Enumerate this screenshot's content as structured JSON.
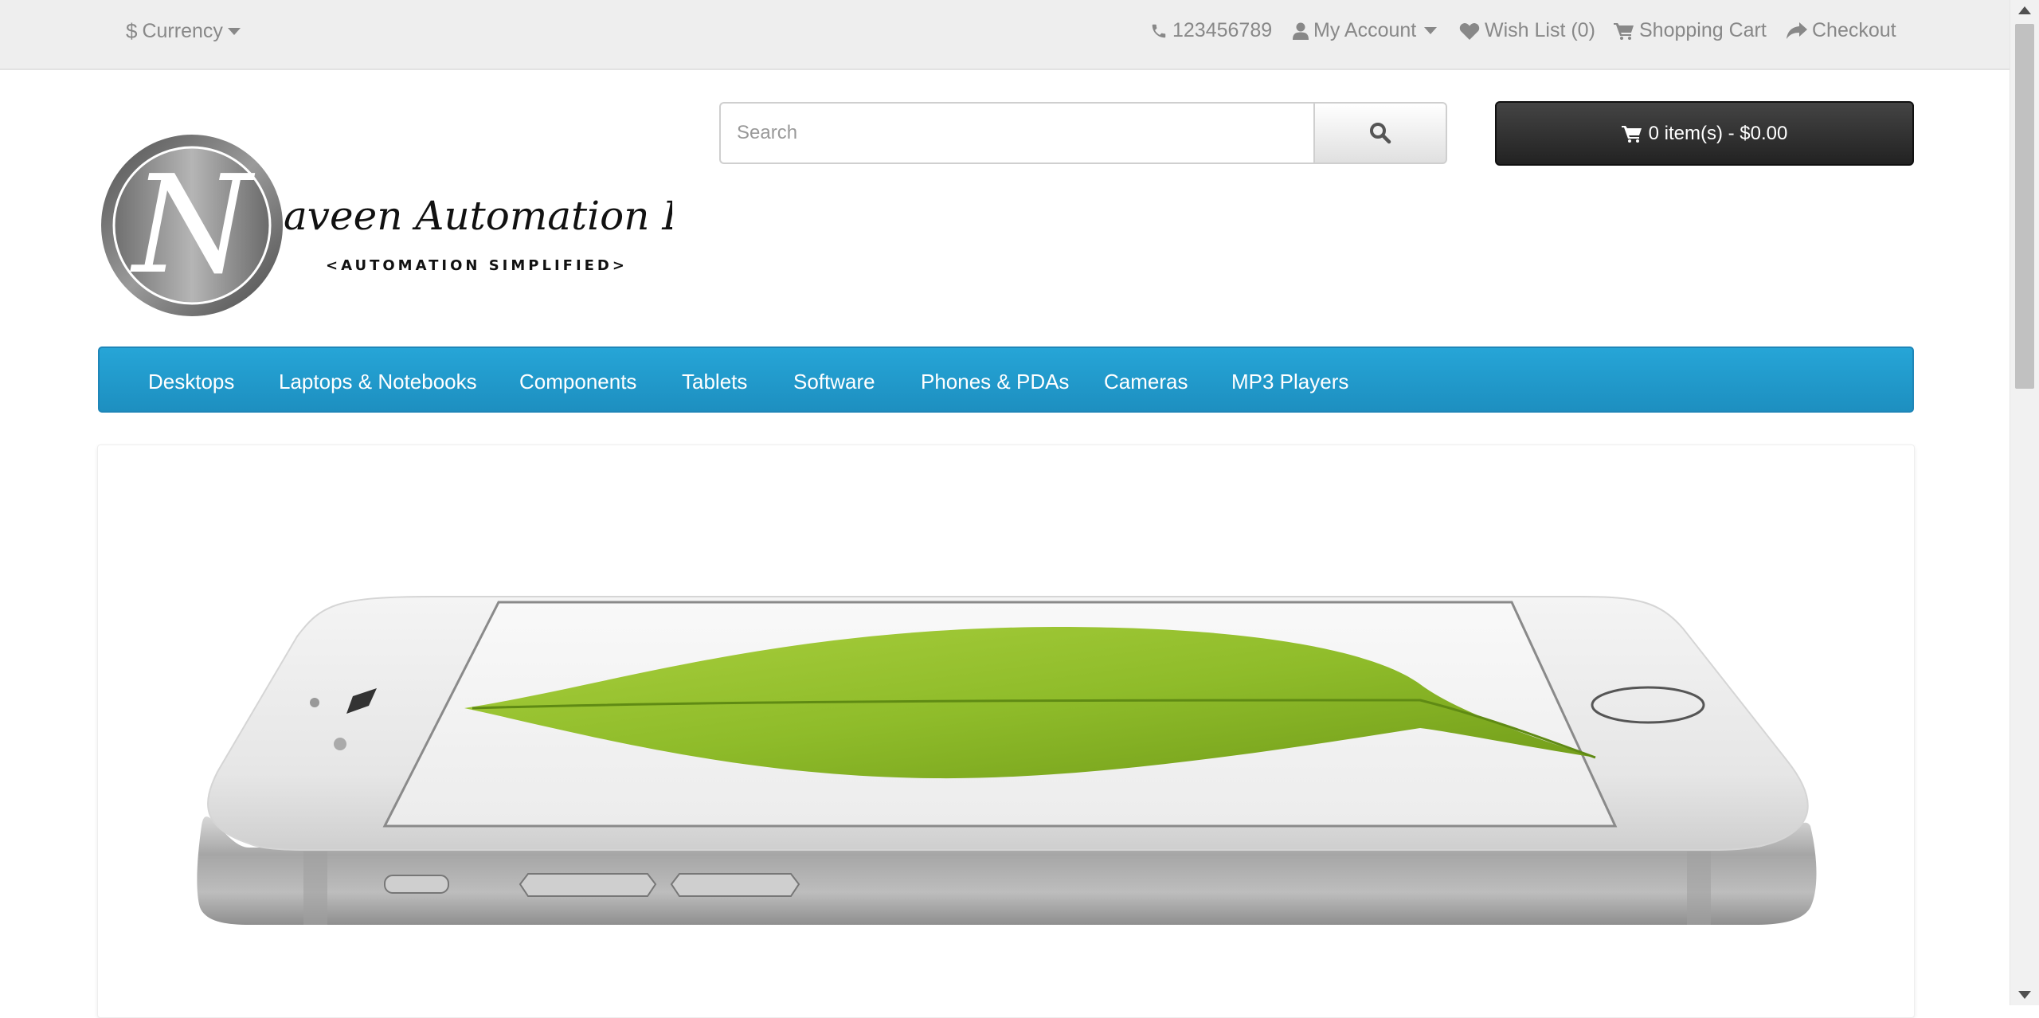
{
  "topbar": {
    "currency_label": "Currency",
    "phone": "123456789",
    "my_account": "My Account",
    "wish_list": "Wish List (0)",
    "shopping_cart": "Shopping Cart",
    "checkout": "Checkout"
  },
  "logo": {
    "initial": "N",
    "name": "aveen Automation Labs",
    "tagline": "<AUTOMATION SIMPLIFIED>"
  },
  "search": {
    "placeholder": "Search"
  },
  "cart": {
    "label": "0 item(s) - $0.00"
  },
  "menu": {
    "items": [
      "Desktops",
      "Laptops & Notebooks",
      "Components",
      "Tablets",
      "Software",
      "Phones & PDAs",
      "Cameras",
      "MP3 Players"
    ]
  },
  "icons": {
    "currency": "dollar-icon",
    "phone": "phone-icon",
    "account": "user-icon",
    "wishlist": "heart-icon",
    "cart": "cart-icon",
    "checkout": "share-icon",
    "search": "search-icon"
  },
  "colors": {
    "topbar_bg": "#eeeeee",
    "menu_bg": "#229ac8",
    "cart_button_bg": "#333333"
  }
}
